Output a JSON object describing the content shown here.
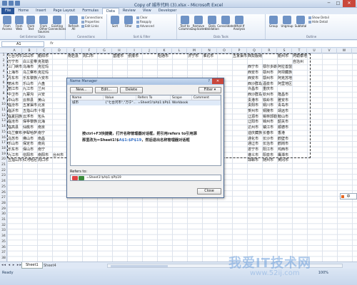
{
  "window": {
    "title": "Copy of 城市代码 (3).xlsx - Microsoft Excel",
    "minimize": "─",
    "maximize": "□",
    "close": "✕"
  },
  "tabs": [
    "File",
    "Home",
    "Insert",
    "Page Layout",
    "Formulas",
    "Data",
    "Review",
    "View",
    "Developer"
  ],
  "ribbon": {
    "groups": [
      {
        "label": "Get External Data",
        "buttons": [
          "From Access",
          "From Web",
          "From Text",
          "From Other Sources",
          "Existing Connections"
        ]
      },
      {
        "label": "Connections",
        "buttons": [
          "Refresh All"
        ],
        "small": [
          "Connections",
          "Properties",
          "Edit Links"
        ]
      },
      {
        "label": "Sort & Filter",
        "buttons": [
          "Sort",
          "Filter"
        ],
        "small": [
          "Clear",
          "Reapply",
          "Advanced"
        ]
      },
      {
        "label": "Data Tools",
        "buttons": [
          "Text to Columns",
          "Remove Duplicates",
          "Data Validation",
          "Consolidate",
          "What-If Analysis"
        ]
      },
      {
        "label": "Outline",
        "buttons": [
          "Group",
          "Ungroup",
          "Subtotal"
        ],
        "small": [
          "Show Detail",
          "Hide Detail"
        ]
      }
    ]
  },
  "formula_bar": {
    "name_box": "A1",
    "fx": "fx"
  },
  "columns": [
    "A",
    "B",
    "C",
    "D",
    "E",
    "F",
    "G",
    "H",
    "I",
    "J",
    "K",
    "L",
    "M",
    "N",
    "O",
    "P",
    "Q",
    "R",
    "S",
    "T",
    "U",
    "V",
    "W"
  ],
  "rows": [
    "1",
    "2",
    "3",
    "4",
    "5",
    "6",
    "7",
    "8",
    "9",
    "10",
    "11",
    "12",
    "13",
    "14",
    "15",
    "16",
    "17",
    "18",
    "19",
    "20",
    "21",
    "22",
    "23",
    "24",
    "25",
    "26",
    "27",
    "28",
    "29",
    "30",
    "31",
    "32",
    "33",
    "34",
    "35",
    "36",
    "37",
    "38"
  ],
  "grid_rows": [
    [
      "七台河市",
      "白山市",
      "衢阳市",
      "",
      "南岩县",
      "周口市",
      "",
      "基隆市",
      "张掖市",
      "",
      "昭通市",
      "",
      "济宁市",
      "淮北市",
      "",
      "五家渠市",
      "西双版纳",
      "",
      "衢州市",
      "阿勒泰地区"
    ],
    [
      "万宁市",
      "白三星带市",
      "克孜勒",
      "",
      "",
      "",
      "",
      "",
      "",
      "",
      "",
      "",
      "",
      "",
      "",
      "",
      "",
      "",
      "",
      "自治州"
    ],
    [
      "三门峡市",
      "乌海市",
      "克拉玛",
      "",
      "",
      "",
      "",
      "",
      "",
      "",
      "",
      "",
      "",
      "",
      "",
      "",
      "西宁市",
      "鄂尔多斯",
      "阿拉善盟"
    ],
    [
      "上海市",
      "乌兰察布",
      "克拉玛",
      "",
      "",
      "",
      "",
      "",
      "",
      "",
      "",
      "",
      "",
      "",
      "",
      "",
      "西安市",
      "鄂州市",
      "阿坝藏族"
    ],
    [
      "丹东市",
      "乐东黎族自",
      "六安市",
      "",
      "",
      "",
      "",
      "",
      "",
      "",
      "",
      "",
      "",
      "",
      "",
      "",
      "西安市",
      "鄂州市",
      "阿克苏地区"
    ],
    [
      "丽水市",
      "乐山市",
      "六盘",
      "",
      "",
      "",
      "",
      "",
      "",
      "",
      "",
      "",
      "",
      "",
      "",
      "",
      "西沙群岛",
      "酒泉市",
      "阿里地区"
    ],
    [
      "丽江市",
      "九江市",
      "兰州",
      "",
      "",
      "",
      "",
      "",
      "",
      "",
      "",
      "",
      "",
      "",
      "",
      "",
      "许昌市",
      "重庆市"
    ],
    [
      "中卫市",
      "九寨沟",
      "兴安",
      "",
      "",
      "",
      "",
      "",
      "",
      "",
      "",
      "",
      "",
      "",
      "",
      "",
      "西沙群岛",
      "钦州市",
      "隆昌市"
    ],
    [
      "中山市",
      "云林县",
      "黄山",
      "",
      "",
      "",
      "",
      "",
      "",
      "",
      "",
      "",
      "",
      "",
      "",
      "",
      "贵港市",
      "铁岭市",
      "雅安市"
    ],
    [
      "临汾市",
      "五家渠市",
      "北京",
      "",
      "",
      "",
      "",
      "",
      "",
      "",
      "",
      "",
      "",
      "",
      "",
      "",
      "贵阳市",
      "铜川市",
      "青岛市"
    ],
    [
      "临沂市",
      "五指山市",
      "十堰",
      "",
      "",
      "",
      "",
      "",
      "",
      "",
      "",
      "",
      "",
      "",
      "",
      "",
      "贺州市",
      "铜陵市",
      "靖远市"
    ],
    [
      "临夏回族自",
      "云浮市",
      "包头",
      "",
      "",
      "",
      "",
      "",
      "",
      "",
      "",
      "",
      "",
      "",
      "",
      "",
      "辽源市",
      "锡林郭勒盟",
      "鞍山市"
    ],
    [
      "临沧市",
      "保亭黎族苗",
      "北海",
      "",
      "",
      "",
      "",
      "",
      "",
      "",
      "",
      "",
      "",
      "",
      "",
      "",
      "辽阳市",
      "锦州市",
      "韶关市"
    ],
    [
      "临高县",
      "仙桃市",
      "南京",
      "",
      "",
      "",
      "",
      "",
      "",
      "",
      "",
      "",
      "",
      "",
      "",
      "",
      "达州市",
      "镇江市",
      "顺德市"
    ],
    [
      "乌兰察布",
      "伊犁哈萨克",
      "南宁",
      "",
      "",
      "",
      "",
      "",
      "",
      "",
      "",
      "",
      "",
      "",
      "",
      "",
      "迪庆藏族",
      "长春市",
      "香港"
    ],
    [
      "乌苏市",
      "佛山市",
      "南昌",
      "",
      "",
      "",
      "",
      "",
      "",
      "",
      "",
      "",
      "",
      "",
      "",
      "",
      "通化市",
      "长沙市",
      "鹤壁市"
    ],
    [
      "乐山市",
      "保定市",
      "南充",
      "",
      "",
      "",
      "",
      "",
      "",
      "",
      "",
      "",
      "",
      "",
      "",
      "",
      "通辽市",
      "长治市",
      "鹤岗市"
    ],
    [
      "乐东市",
      "保山市",
      "南宁",
      "",
      "",
      "",
      "",
      "",
      "",
      "",
      "",
      "",
      "",
      "",
      "",
      "",
      "遂宁市",
      "阳江市",
      "鸡西市"
    ],
    [
      "九江市",
      "信阳市",
      "南阳市",
      "台州市",
      "",
      "宜宾市",
      "",
      "新余市",
      "",
      "",
      "",
      "",
      "",
      "",
      "",
      "",
      "遵义市",
      "阳泉市",
      "鹰潭市"
    ],
    [
      "五指山市",
      "红河哈尼族彝族",
      "周口市",
      "",
      "",
      "",
      "",
      "",
      "",
      "",
      "",
      "",
      "",
      "",
      "",
      "",
      "邯郸市",
      "随州市",
      "黄冈市"
    ]
  ],
  "dialog": {
    "title": "Name Manager",
    "help": "?",
    "close": "✕",
    "btn_new": "New...",
    "btn_edit": "Edit...",
    "btn_delete": "Delete",
    "btn_filter": "Filter ▾",
    "headers": [
      "Name",
      "Value",
      "Refers To",
      "Scope",
      "Comment"
    ],
    "row": {
      "name": "城市",
      "value": "{\"七台河市\",\"万宁\"...",
      "refers_to": "=Sheet1!$A$1:$P$19",
      "scope": "Workbook",
      "comment": ""
    },
    "note_line1": "按ctrl+F3快捷键，打开名称管理器对话框，把引用refers to引用源",
    "note_line2_pre": "那里改为=Sheet1!$",
    "note_line2_hl": "A$1:$P$19",
    "note_line2_post": "，然后退出名称管理器对话框",
    "refers_label": "Refers to:",
    "refers_value": "=Sheet1!$A$1:$P$19",
    "close_button": "Close"
  },
  "sheets": {
    "nav": "◂◂ ◂ ▸ ▸▸",
    "tab1": "Sheet1",
    "tab2": "Sheet4"
  },
  "status": {
    "ready": "Ready",
    "zoom": "100%"
  },
  "ime": "中",
  "watermark": {
    "big": "我爱IT技术网",
    "small": "www.52ij.com"
  },
  "colors": {
    "accent": "#2b579a",
    "dialog_border": "#4d6b95",
    "highlight_text": "#3a73c5",
    "close_red": "#c9473b"
  }
}
